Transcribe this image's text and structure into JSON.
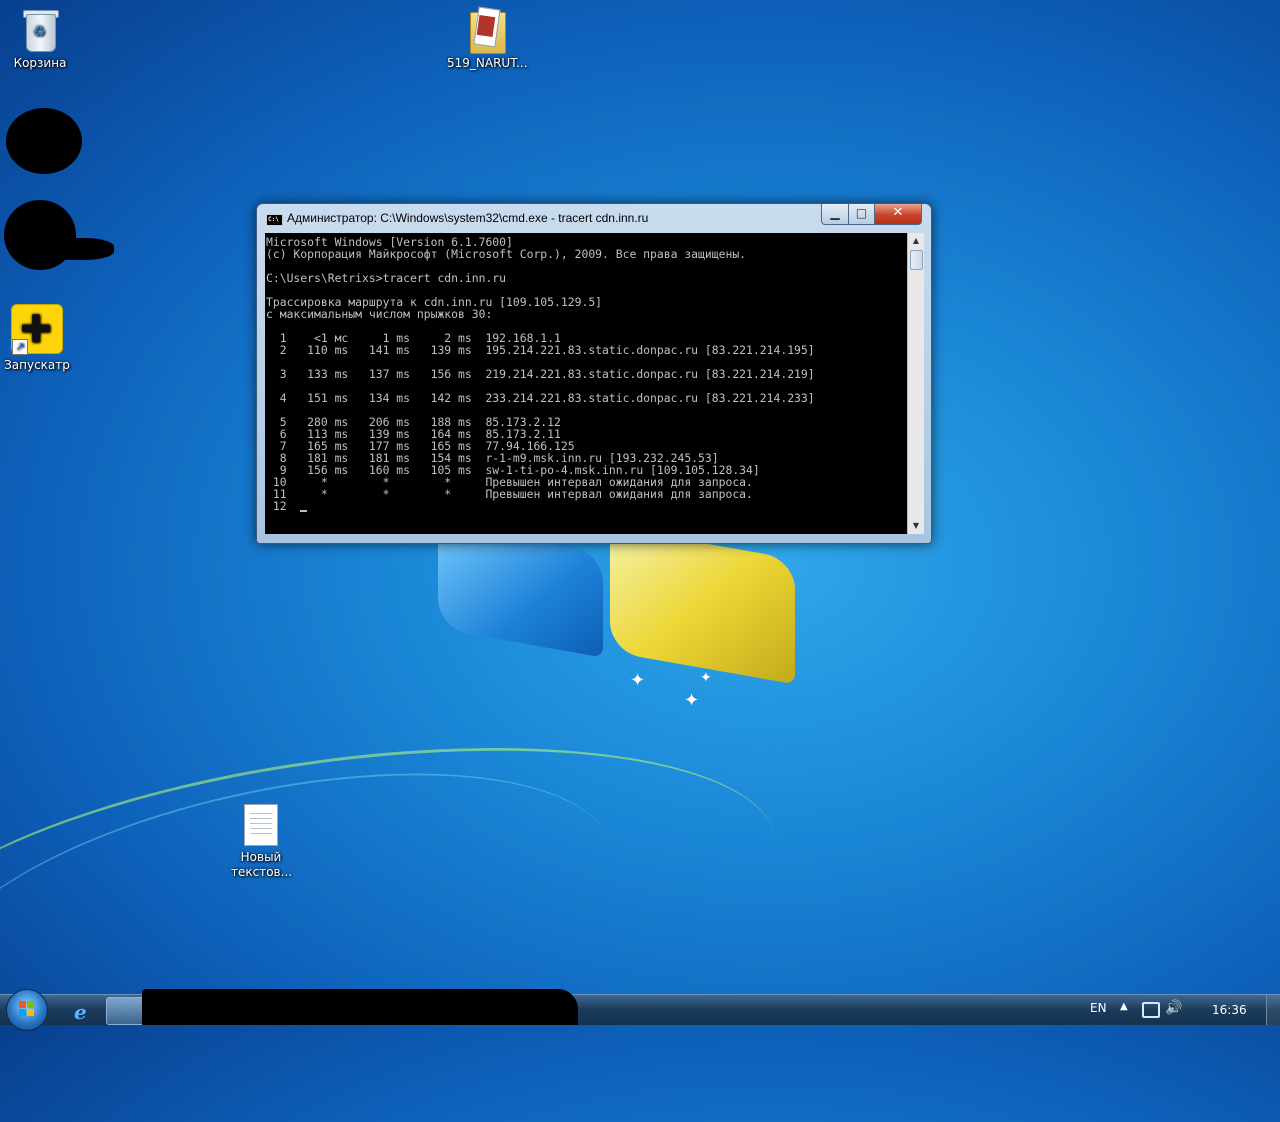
{
  "desktop": {
    "icons": [
      {
        "label": "Корзина"
      },
      {
        "label": "519_NARUT..."
      },
      {
        "label": "Запускатр"
      },
      {
        "label": "Новый текстов..."
      }
    ]
  },
  "cmd_window": {
    "title": "Администратор: C:\\Windows\\system32\\cmd.exe - tracert  cdn.inn.ru",
    "icon_text": "C:\\",
    "minimize_glyph": "▁",
    "maximize_glyph": "□",
    "close_glyph": "✕",
    "console_lines": [
      "Microsoft Windows [Version 6.1.7600]",
      "(c) Корпорация Майкрософт (Microsoft Corp.), 2009. Все права защищены.",
      "",
      "C:\\Users\\Retrixs>tracert cdn.inn.ru",
      "",
      "Трассировка маршрута к cdn.inn.ru [109.105.129.5]",
      "с максимальным числом прыжков 30:",
      "",
      "  1    <1 мс     1 ms     2 ms  192.168.1.1",
      "  2   110 ms   141 ms   139 ms  195.214.221.83.static.donpac.ru [83.221.214.195]",
      "",
      "  3   133 ms   137 ms   156 ms  219.214.221.83.static.donpac.ru [83.221.214.219]",
      "",
      "  4   151 ms   134 ms   142 ms  233.214.221.83.static.donpac.ru [83.221.214.233]",
      "",
      "  5   280 ms   206 ms   188 ms  85.173.2.12",
      "  6   113 ms   139 ms   164 ms  85.173.2.11",
      "  7   165 ms   177 ms   165 ms  77.94.166.125",
      "  8   181 ms   181 ms   154 ms  r-1-m9.msk.inn.ru [193.232.245.53]",
      "  9   156 ms   160 ms   105 ms  sw-1-ti-po-4.msk.inn.ru [109.105.128.34]",
      " 10     *        *        *     Превышен интервал ожидания для запроса.",
      " 11     *        *        *     Превышен интервал ожидания для запроса.",
      " 12  "
    ]
  },
  "taskbar": {
    "language": "EN",
    "tray_arrow": "▲",
    "volume_glyph": "🔊",
    "clock": "16:36",
    "ie_glyph": "e"
  },
  "colors": {
    "console_bg": "#000000",
    "console_fg": "#c0c0c0",
    "close_red": "#c8442c"
  }
}
